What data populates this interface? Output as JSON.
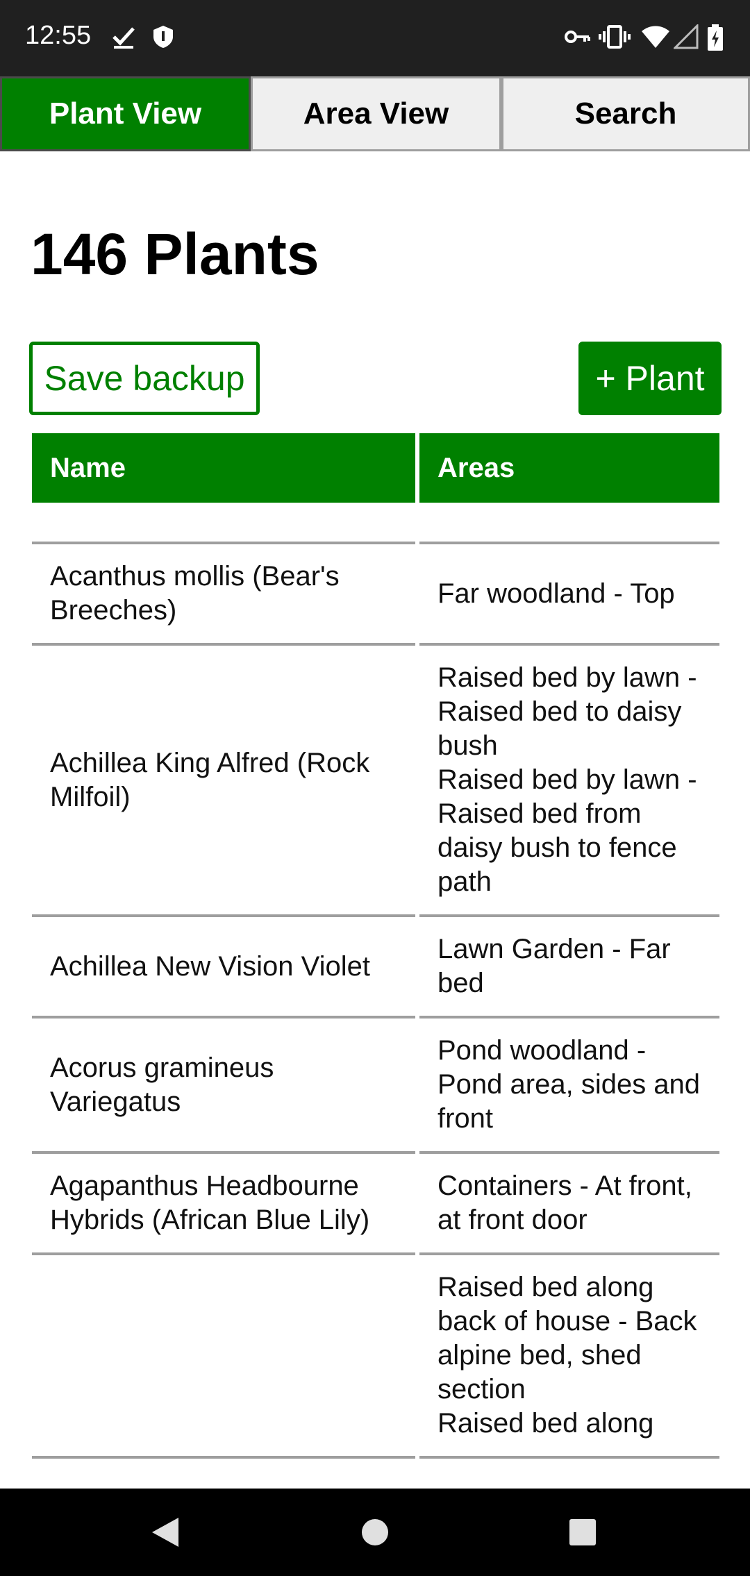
{
  "status_bar": {
    "time": "12:55",
    "icons": [
      "checkmark-icon",
      "shield-icon",
      "key-icon",
      "vibrate-icon",
      "wifi-icon",
      "signal-icon",
      "battery-charging-icon"
    ]
  },
  "tabs": [
    {
      "label": "Plant View",
      "active": true
    },
    {
      "label": "Area View",
      "active": false
    },
    {
      "label": "Search",
      "active": false
    }
  ],
  "page": {
    "title": "146 Plants",
    "save_backup_label": "Save backup",
    "add_plant_label": "+ Plant"
  },
  "table": {
    "headers": {
      "name": "Name",
      "areas": "Areas"
    },
    "rows": [
      {
        "name": "Acanthus mollis (Bear's Breeches)",
        "areas": [
          "Far woodland - Top"
        ]
      },
      {
        "name": "Achillea King Alfred (Rock Milfoil)",
        "areas": [
          "Raised bed by lawn - Raised bed to daisy bush",
          "Raised bed by lawn - Raised bed from daisy bush to fence path"
        ]
      },
      {
        "name": "Achillea New Vision Violet",
        "areas": [
          "Lawn Garden - Far bed"
        ]
      },
      {
        "name": "Acorus gramineus Variegatus",
        "areas": [
          "Pond woodland - Pond area, sides and front"
        ]
      },
      {
        "name": "Agapanthus Headbourne Hybrids (African Blue Lily)",
        "areas": [
          "Containers - At front, at front door"
        ]
      },
      {
        "name": "",
        "areas": [
          "Raised bed along back of house - Back alpine bed, shed section",
          "Raised bed along"
        ]
      }
    ]
  },
  "colors": {
    "accent": "#008000",
    "status_bar": "#202020",
    "tab_inactive": "#efefef",
    "divider": "#9e9e9e"
  }
}
